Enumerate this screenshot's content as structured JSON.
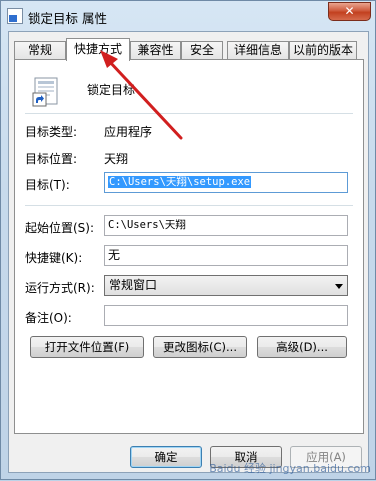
{
  "window": {
    "title": "锁定目标 属性",
    "close_label": "✕"
  },
  "tabs": [
    {
      "label": "常规"
    },
    {
      "label": "快捷方式",
      "active": true
    },
    {
      "label": "兼容性"
    },
    {
      "label": "安全"
    },
    {
      "label": "详细信息"
    },
    {
      "label": "以前的版本"
    }
  ],
  "shortcut": {
    "name": "锁定目标",
    "target_type_label": "目标类型:",
    "target_type_value": "应用程序",
    "target_location_label": "目标位置:",
    "target_location_value": "天翔",
    "target_label": "目标(T):",
    "target_value": "C:\\Users\\天翔\\setup.exe",
    "start_in_label": "起始位置(S):",
    "start_in_value": "C:\\Users\\天翔",
    "hotkey_label": "快捷键(K):",
    "hotkey_value": "无",
    "run_label": "运行方式(R):",
    "run_value": "常规窗口",
    "comment_label": "备注(O):",
    "comment_value": ""
  },
  "actions": {
    "open_location": "打开文件位置(F)",
    "change_icon": "更改图标(C)...",
    "advanced": "高级(D)..."
  },
  "footer": {
    "ok": "确定",
    "cancel": "取消",
    "apply": "应用(A)"
  },
  "annotation_color": "#d11f1f",
  "watermark": "Baidu 经验 jingyan.baidu.com"
}
